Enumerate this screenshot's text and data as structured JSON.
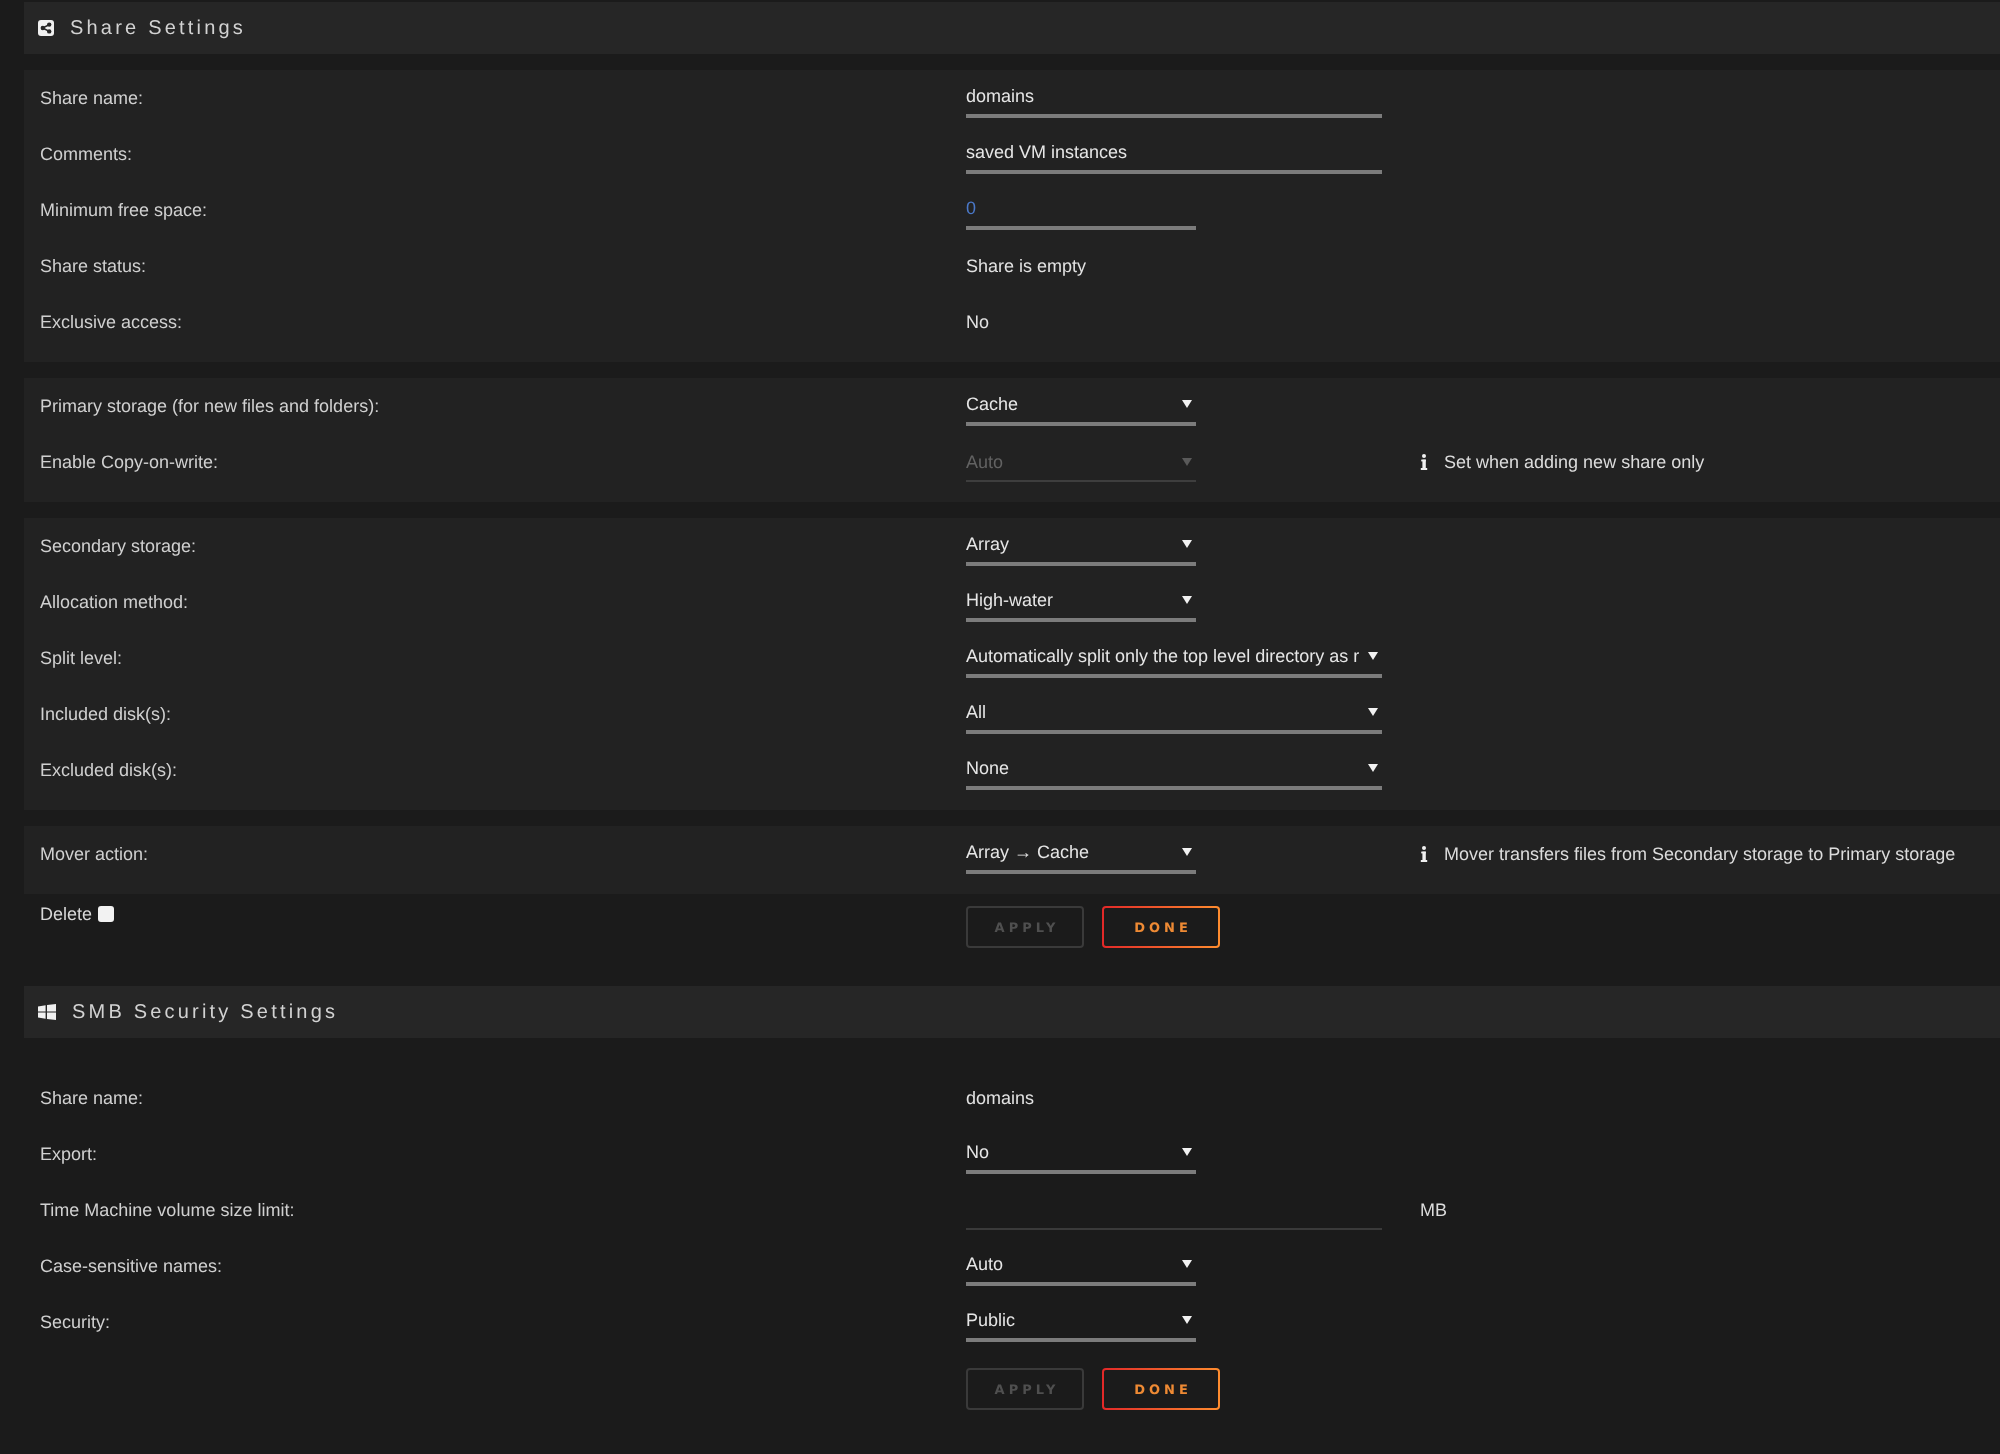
{
  "share_settings": {
    "title": "Share Settings",
    "groups": [
      {
        "rows": [
          {
            "kind": "text_input",
            "label": "Share name:",
            "value": "domains"
          },
          {
            "kind": "text_input",
            "label": "Comments:",
            "value": "saved VM instances"
          },
          {
            "kind": "short_input",
            "label": "Minimum free space:",
            "placeholder": "0"
          },
          {
            "kind": "static",
            "label": "Share status:",
            "value": "Share is empty"
          },
          {
            "kind": "static",
            "label": "Exclusive access:",
            "value": "No"
          }
        ]
      },
      {
        "rows": [
          {
            "kind": "select",
            "label": "Primary storage (for new files and folders):",
            "value": "Cache",
            "disabled": false
          },
          {
            "kind": "select",
            "label": "Enable Copy-on-write:",
            "value": "Auto",
            "disabled": true,
            "note": "Set when adding new share only"
          }
        ]
      },
      {
        "rows": [
          {
            "kind": "select",
            "label": "Secondary storage:",
            "value": "Array",
            "disabled": false
          },
          {
            "kind": "select",
            "label": "Allocation method:",
            "value": "High-water",
            "disabled": false
          },
          {
            "kind": "wide_select",
            "label": "Split level:",
            "value": "Automatically split only the top level directory as r",
            "disabled": false
          },
          {
            "kind": "wide_select",
            "label": "Included disk(s):",
            "value": "All",
            "disabled": false
          },
          {
            "kind": "wide_select",
            "label": "Excluded disk(s):",
            "value": "None",
            "disabled": false
          }
        ]
      },
      {
        "rows": [
          {
            "kind": "select",
            "label": "Mover action:",
            "value": "Array → Cache",
            "disabled": false,
            "note": "Mover transfers files from Secondary storage to Primary storage"
          }
        ]
      }
    ],
    "delete": {
      "label": "Delete",
      "checked": false
    },
    "buttons": [
      {
        "label": "APPLY",
        "disabled": true
      },
      {
        "label": "DONE",
        "disabled": false
      }
    ]
  },
  "smb_security_settings": {
    "title": "SMB Security Settings",
    "rows": [
      {
        "kind": "static",
        "label": "Share name:",
        "value": "domains"
      },
      {
        "kind": "select",
        "label": "Export:",
        "value": "No",
        "disabled": false
      },
      {
        "kind": "unit_input",
        "label": "Time Machine volume size limit:",
        "unit": "MB"
      },
      {
        "kind": "select",
        "label": "Case-sensitive names:",
        "value": "Auto",
        "disabled": false
      },
      {
        "kind": "select",
        "label": "Security:",
        "value": "Public",
        "disabled": false
      }
    ],
    "buttons": [
      {
        "label": "APPLY",
        "disabled": true
      },
      {
        "label": "DONE",
        "disabled": false
      }
    ]
  }
}
